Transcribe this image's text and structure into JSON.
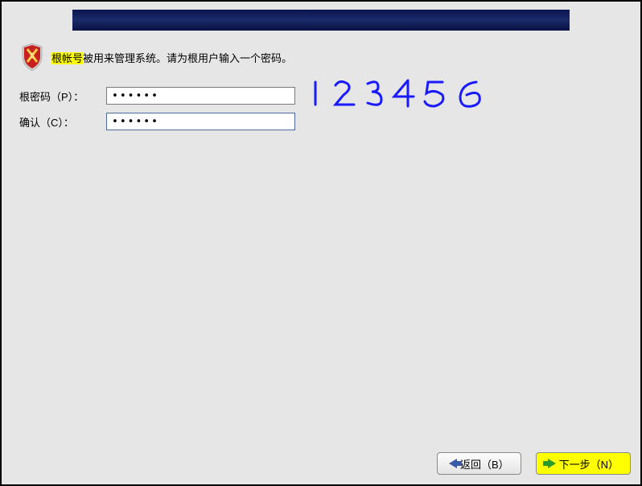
{
  "intro": {
    "highlighted": "根帐号",
    "rest": "被用来管理系统。请为根用户输入一个密码。"
  },
  "form": {
    "password_label": "根密码（P）：",
    "password_value": "••••••",
    "confirm_label": "确认（C）：",
    "confirm_value": "••••••"
  },
  "handwriting": {
    "text": "123456"
  },
  "buttons": {
    "back": "返回（B）",
    "next": "下一步（N）"
  }
}
